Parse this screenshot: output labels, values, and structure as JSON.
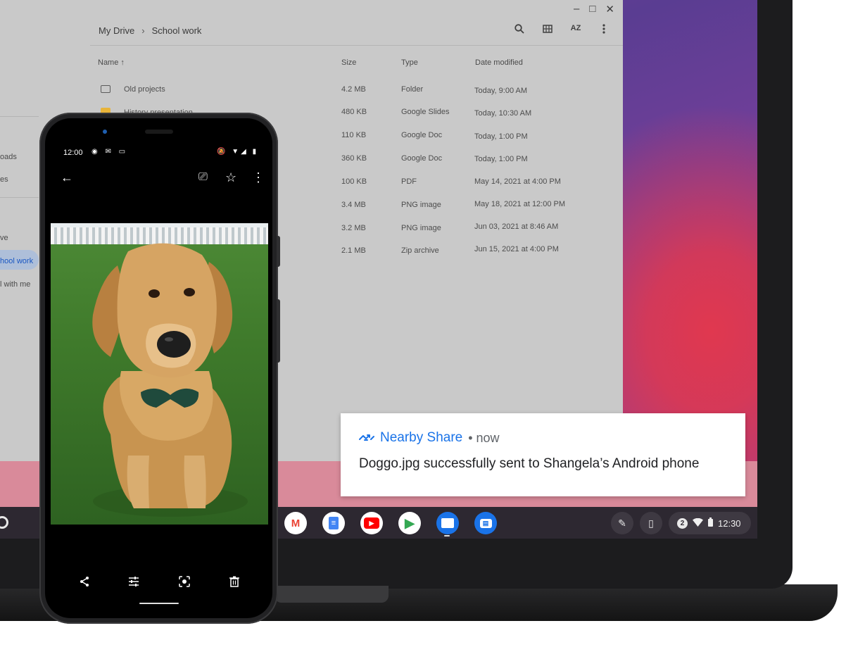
{
  "files_app": {
    "window_controls": {
      "minimize": "–",
      "maximize": "□",
      "close": "✕"
    },
    "breadcrumb": {
      "root": "My Drive",
      "separator": "›",
      "current": "School work"
    },
    "toolbar": {
      "search_icon": "search-icon",
      "grid_icon": "grid-view-icon",
      "sort_label": "AZ",
      "menu_icon": "more-vert-icon"
    },
    "columns": {
      "name": "Name ↑",
      "size": "Size",
      "type": "Type",
      "date": "Date modified"
    },
    "rows": [
      {
        "name": "Old projects",
        "size": "4.2 MB",
        "type": "Folder",
        "date": "Today, 9:00 AM"
      },
      {
        "name": "History presentation",
        "size": "480 KB",
        "type": "Google Slides",
        "date": "Today, 10:30 AM"
      },
      {
        "name": "",
        "size": "110 KB",
        "type": "Google Doc",
        "date": "Today, 1:00 PM"
      },
      {
        "name": "",
        "size": "360 KB",
        "type": "Google Doc",
        "date": "Today, 1:00 PM"
      },
      {
        "name": "",
        "size": "100 KB",
        "type": "PDF",
        "date": "May 14, 2021 at 4:00 PM"
      },
      {
        "name": "",
        "size": "3.4 MB",
        "type": "PNG image",
        "date": "May 18, 2021 at 12:00 PM"
      },
      {
        "name": "",
        "size": "3.2 MB",
        "type": "PNG image",
        "date": "Jun 03, 2021 at 8:46 AM"
      },
      {
        "name": "",
        "size": "2.1 MB",
        "type": "Zip archive",
        "date": "Jun 15, 2021 at 4:00 PM"
      }
    ],
    "sidebar": {
      "items": [
        "oads",
        "es",
        "ve",
        "hool work",
        "l with me"
      ]
    }
  },
  "notification": {
    "icon": "nearby-share-icon",
    "app": "Nearby Share",
    "time": "• now",
    "message": "Doggo.jpg successfully sent to Shangela’s Android phone"
  },
  "shelf": {
    "apps": [
      {
        "name": "gmail",
        "glyph": "M",
        "color": "#ea4335"
      },
      {
        "name": "docs",
        "glyph": "≡",
        "color": "#4285f4"
      },
      {
        "name": "youtube",
        "glyph": "▶",
        "color": "#ff0000"
      },
      {
        "name": "play-store",
        "glyph": "▶",
        "color": "#34a853"
      },
      {
        "name": "files",
        "glyph": "■",
        "color": "#1a73e8"
      },
      {
        "name": "messages",
        "glyph": "▤",
        "color": "#1a73e8"
      }
    ],
    "tray": {
      "pen_icon": "✎",
      "phone_hub_icon": "▯",
      "notification_count": "2",
      "time": "12:30"
    }
  },
  "phone": {
    "status_time": "12:00",
    "status_notifs": "◉ ✉ ▭",
    "status_system": "🔕 ▼◢ ▮",
    "top_actions": {
      "back": "←",
      "cast": "⎚",
      "star": "☆",
      "menu": "⋮"
    },
    "bottom_actions": {
      "share": "<",
      "edit": "☷",
      "lens": "◎",
      "delete": "🗑"
    }
  }
}
